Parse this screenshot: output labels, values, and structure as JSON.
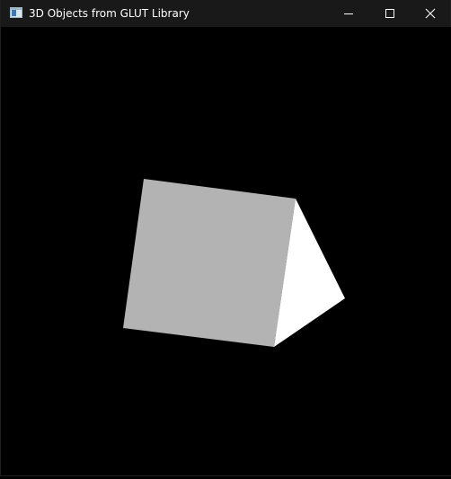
{
  "window": {
    "title": "3D Objects from GLUT Library",
    "background_color": "#000000",
    "titlebar_color": "#191919"
  },
  "titlebar": {
    "icon": "app-window-icon",
    "controls": [
      {
        "name": "minimize-icon"
      },
      {
        "name": "maximize-icon"
      },
      {
        "name": "close-icon"
      }
    ]
  },
  "scene": {
    "object": "triangular prism",
    "faces": [
      {
        "name": "front-face",
        "color": "#b3b3b3"
      },
      {
        "name": "side-face",
        "color": "#ffffff"
      }
    ]
  }
}
